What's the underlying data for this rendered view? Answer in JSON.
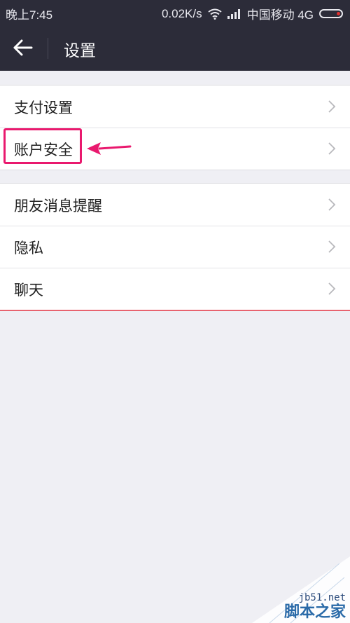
{
  "status_bar": {
    "time": "晚上7:45",
    "network_speed": "0.02K/s",
    "carrier": "中国移动 4G",
    "icons": [
      "wifi-icon",
      "signal-icon",
      "battery-icon"
    ]
  },
  "header": {
    "title": "设置",
    "back_icon": "arrow-left-icon"
  },
  "settings_groups": [
    {
      "items": [
        {
          "label": "支付设置"
        },
        {
          "label": "账户安全",
          "highlighted": true
        }
      ]
    },
    {
      "items": [
        {
          "label": "朋友消息提醒"
        },
        {
          "label": "隐私"
        },
        {
          "label": "聊天"
        }
      ]
    }
  ],
  "annotation": {
    "color": "#e9196e",
    "target": "账户安全"
  },
  "watermark": {
    "site": "jb51.net",
    "name": "脚本之家"
  },
  "colors": {
    "header_bg": "#2c2c39",
    "page_bg": "#efeff4",
    "bottom_line": "#e8636f"
  }
}
